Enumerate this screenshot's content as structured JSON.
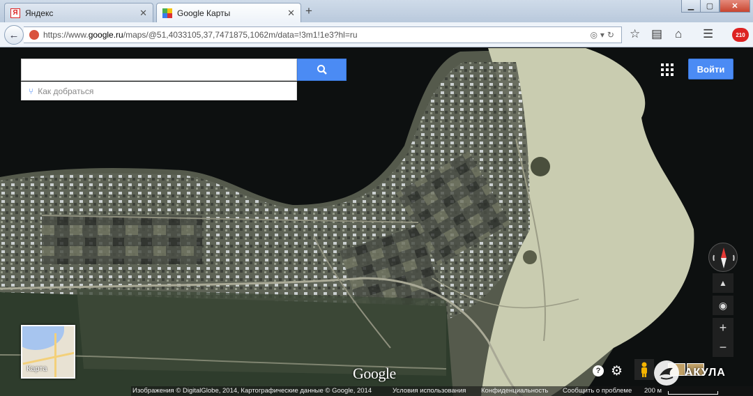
{
  "browser": {
    "tabs": [
      {
        "label": "Яндекс",
        "favicon": "yandex-icon",
        "active": false
      },
      {
        "label": "Google Карты",
        "favicon": "google-maps-icon",
        "active": true
      }
    ],
    "new_tab": "+",
    "url": {
      "prefix": "https://www.",
      "host": "google.ru",
      "path": "/maps/@51,4033105,37,7471875,1062m/data=!3m1!1e3?hl=ru"
    },
    "notification_count": "210",
    "icons": [
      "back-arrow-icon",
      "bookmark-star-icon",
      "clipboard-icon",
      "home-icon",
      "menu-icon"
    ]
  },
  "map": {
    "search": {
      "placeholder": "",
      "value": ""
    },
    "directions_label": "Как добраться",
    "signin_label": "Войти",
    "minimap_label": "Карта",
    "logo_text": "Google",
    "view": "satellite",
    "zoom_in": "+",
    "zoom_out": "−",
    "footer": {
      "imagery": "Изображения © DigitalGlobe, 2014, Картографические данные © Google, 2014",
      "terms": "Условия использования",
      "privacy": "Конфиденциальность",
      "report": "Сообщить о проблеме",
      "scale": "200 м"
    }
  },
  "watermark": {
    "text": "АКУЛА"
  },
  "colors": {
    "accent_blue": "#4b8bf4",
    "water": "#0d1010",
    "land": "#cfd3b8"
  }
}
